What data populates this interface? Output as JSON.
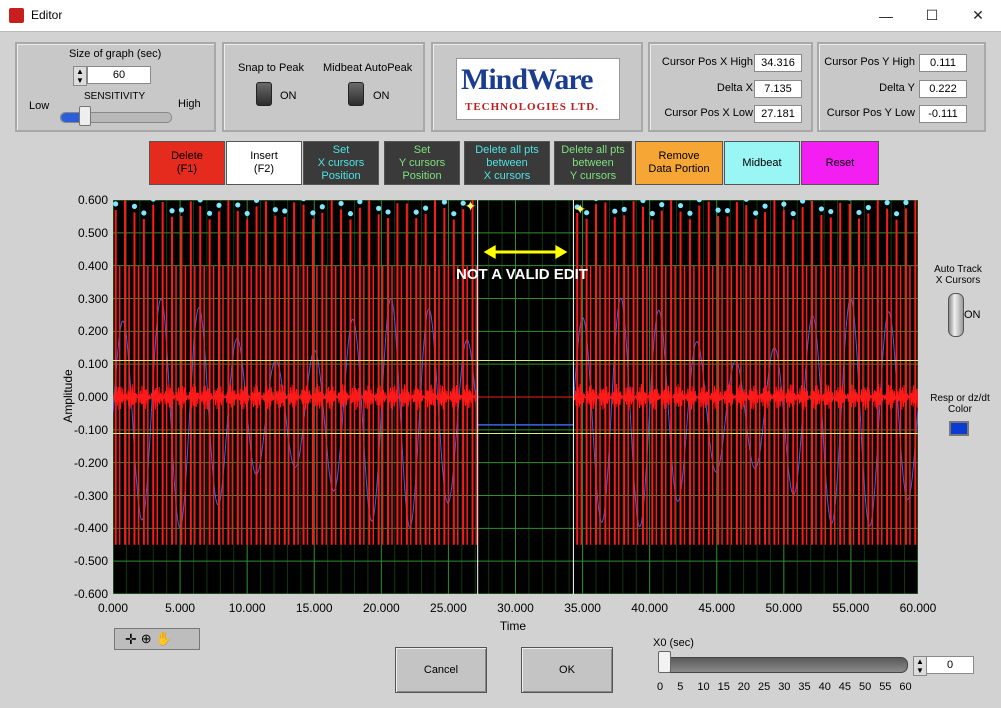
{
  "window": {
    "title": "Editor",
    "minimize": "—",
    "maximize": "☐",
    "close": "✕"
  },
  "graph_size": {
    "label": "Size of graph (sec)",
    "value": "60",
    "sensitivity_label": "SENSITIVITY",
    "low": "Low",
    "high": "High"
  },
  "snap": {
    "snap_label": "Snap to Peak",
    "snap_state": "ON",
    "midbeat_label": "Midbeat AutoPeak",
    "midbeat_state": "ON"
  },
  "logo": {
    "line1": "MindWare",
    "line2": "TECHNOLOGIES LTD."
  },
  "cursor_x": {
    "high_label": "Cursor Pos X High",
    "high_value": "34.316",
    "delta_label": "Delta X",
    "delta_value": "7.135",
    "low_label": "Cursor Pos X Low",
    "low_value": "27.181"
  },
  "cursor_y": {
    "high_label": "Cursor Pos Y High",
    "high_value": "0.111",
    "delta_label": "Delta Y",
    "delta_value": "0.222",
    "low_label": "Cursor Pos Y Low",
    "low_value": "-0.111"
  },
  "toolbar": {
    "delete": {
      "l1": "Delete",
      "l2": "(F1)",
      "bg": "#e52a1e",
      "fg": "#000000"
    },
    "insert": {
      "l1": "Insert",
      "l2": "(F2)",
      "bg": "#ffffff",
      "fg": "#000000"
    },
    "set_x": {
      "l1": "Set",
      "l2": "X cursors",
      "l3": "Position",
      "bg": "#3a3a3a",
      "fg": "#4fe3e3"
    },
    "set_y": {
      "l1": "Set",
      "l2": "Y cursors",
      "l3": "Position",
      "bg": "#3a3a3a",
      "fg": "#7ee07e"
    },
    "del_x": {
      "l1": "Delete all pts",
      "l2": "between",
      "l3": "X cursors",
      "bg": "#3a3a3a",
      "fg": "#4fe3e3"
    },
    "del_y": {
      "l1": "Delete all pts",
      "l2": "between",
      "l3": "Y cursors",
      "bg": "#3a3a3a",
      "fg": "#7ee07e"
    },
    "remove": {
      "l1": "Remove",
      "l2": "Data Portion",
      "bg": "#f6a634",
      "fg": "#000000"
    },
    "midbeat": {
      "l1": "Midbeat",
      "bg": "#9af5f5",
      "fg": "#000000"
    },
    "reset": {
      "l1": "Reset",
      "bg": "#f21ef2",
      "fg": "#000000"
    }
  },
  "plot": {
    "ylabel": "Amplitude",
    "xlabel": "Time",
    "annotation": "NOT A VALID EDIT",
    "yticks": [
      "0.600",
      "0.500",
      "0.400",
      "0.300",
      "0.200",
      "0.100",
      "0.000",
      "-0.100",
      "-0.200",
      "-0.300",
      "-0.400",
      "-0.500",
      "-0.600"
    ],
    "xticks": [
      "0.000",
      "5.000",
      "10.000",
      "15.000",
      "20.000",
      "25.000",
      "30.000",
      "35.000",
      "40.000",
      "45.000",
      "50.000",
      "55.000",
      "60.000"
    ],
    "colors": {
      "ecg": "#ff1a1a",
      "resp": "#3c64e6",
      "grid": "#2f8f2f",
      "cursor_x": "#ffffff",
      "cursor_y": "#d7f07a",
      "peak": "#7fe7ff",
      "arrow": "#ffff00"
    }
  },
  "chart_data": {
    "type": "line",
    "xlabel": "Time",
    "ylabel": "Amplitude",
    "xlim": [
      0,
      60
    ],
    "ylim": [
      -0.6,
      0.6
    ],
    "grid": true,
    "cursors": {
      "x_low": 27.181,
      "x_high": 34.316,
      "y_low": -0.111,
      "y_high": 0.111
    },
    "invalid_region": [
      27.181,
      34.316
    ],
    "series": [
      {
        "name": "ECG",
        "type": "spikes",
        "peak_times": [
          0.2,
          0.9,
          1.6,
          2.3,
          3.0,
          3.7,
          4.4,
          5.1,
          5.8,
          6.5,
          7.2,
          7.9,
          8.6,
          9.3,
          10.0,
          10.7,
          11.4,
          12.1,
          12.8,
          13.5,
          14.2,
          14.9,
          15.6,
          16.3,
          17.0,
          17.7,
          18.4,
          19.1,
          19.8,
          20.5,
          21.2,
          21.9,
          22.6,
          23.3,
          24.0,
          24.7,
          25.4,
          26.1,
          26.8,
          34.6,
          35.3,
          36.0,
          36.7,
          37.4,
          38.1,
          38.8,
          39.5,
          40.2,
          40.9,
          41.6,
          42.3,
          43.0,
          43.7,
          44.4,
          45.1,
          45.8,
          46.5,
          47.2,
          47.9,
          48.6,
          49.3,
          50.0,
          50.7,
          51.4,
          52.1,
          52.8,
          53.5,
          54.2,
          54.9,
          55.6,
          56.3,
          57.0,
          57.7,
          58.4,
          59.1,
          59.8
        ],
        "peak_amplitude": 0.57
      },
      {
        "name": "Resp or dz/dt",
        "type": "wave",
        "note": "oscillation approx. amplitude 0.2-0.45"
      }
    ]
  },
  "side": {
    "auto_track": "Auto Track",
    "auto_track2": "X Cursors",
    "auto_state": "ON",
    "resp_label": "Resp or dz/dt",
    "resp_label2": "Color",
    "resp_color": "#0a3cd4"
  },
  "footer": {
    "cancel": "Cancel",
    "ok": "OK",
    "x0_label": "X0 (sec)",
    "x0_value": "0",
    "x0_ticks": [
      "0",
      "5",
      "10",
      "15",
      "20",
      "25",
      "30",
      "35",
      "40",
      "45",
      "50",
      "55",
      "60"
    ]
  }
}
